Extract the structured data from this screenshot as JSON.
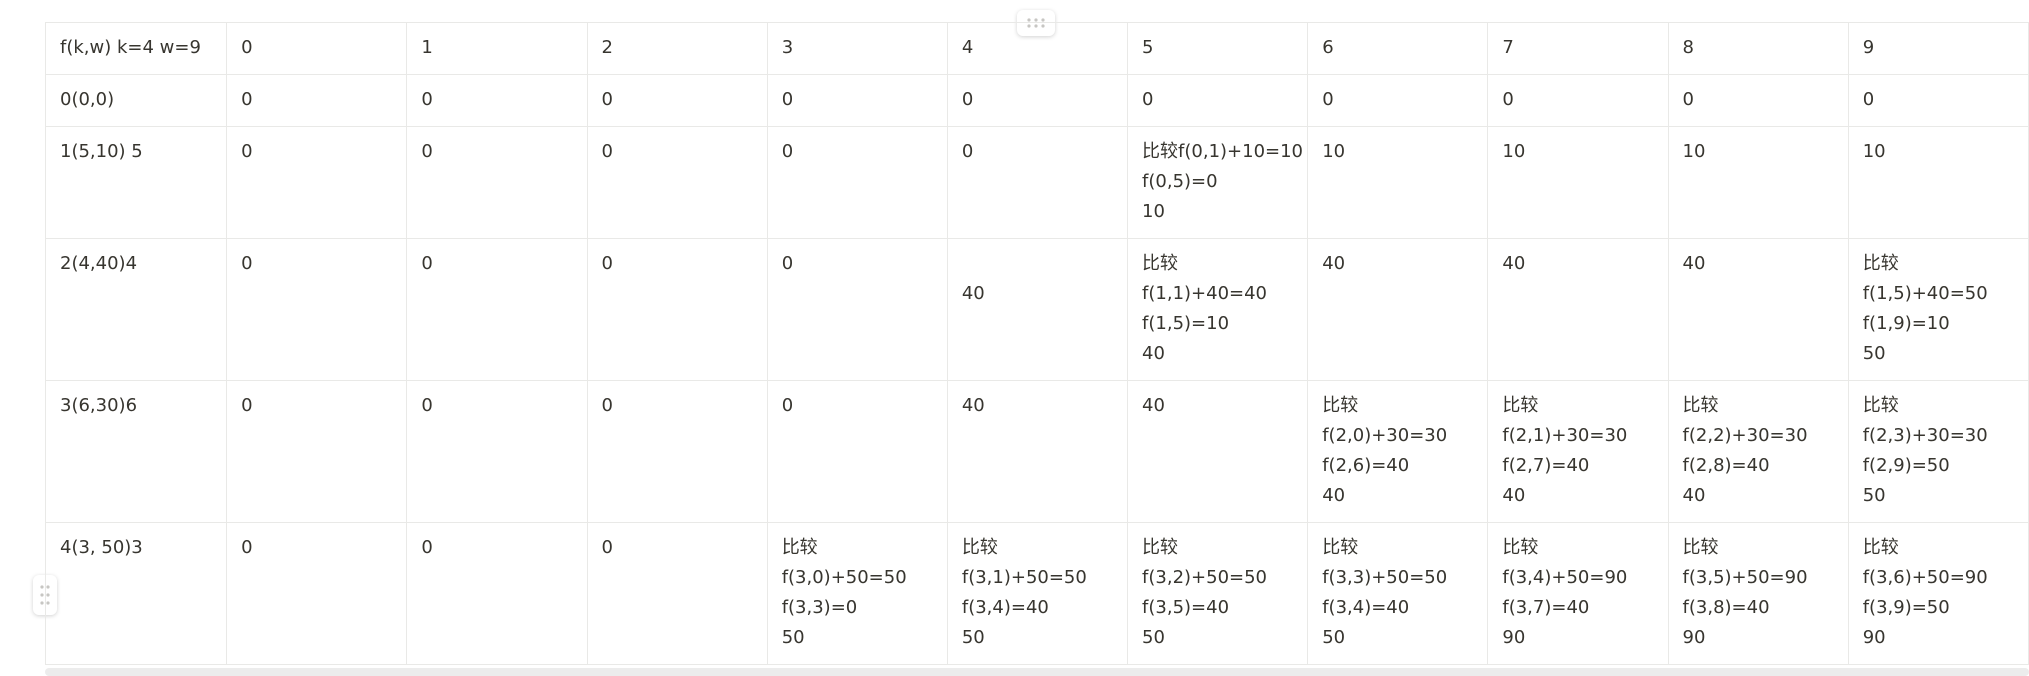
{
  "table": {
    "header": [
      "f(k,w)  k=4 w=9",
      "0",
      "1",
      "2",
      "3",
      "4",
      "5",
      "6",
      "7",
      "8",
      "9"
    ],
    "rows": [
      {
        "cells": [
          [
            "0(0,0)"
          ],
          [
            "0"
          ],
          [
            "0"
          ],
          [
            "0"
          ],
          [
            "0"
          ],
          [
            "0"
          ],
          [
            "0"
          ],
          [
            "0"
          ],
          [
            "0"
          ],
          [
            "0"
          ],
          [
            "0"
          ]
        ]
      },
      {
        "cells": [
          [
            "1(5,10) 5"
          ],
          [
            "0"
          ],
          [
            "0"
          ],
          [
            "0"
          ],
          [
            "0"
          ],
          [
            "0"
          ],
          [
            "比较f(0,1)+10=10",
            "f(0,5)=0",
            "10"
          ],
          [
            "10"
          ],
          [
            "10"
          ],
          [
            "10"
          ],
          [
            "10"
          ]
        ]
      },
      {
        "cells": [
          [
            "2(4,40)4"
          ],
          [
            "0"
          ],
          [
            "0"
          ],
          [
            "0"
          ],
          [
            "0"
          ],
          [
            "",
            "40"
          ],
          [
            "比较",
            "f(1,1)+40=40",
            "f(1,5)=10",
            "40"
          ],
          [
            "40"
          ],
          [
            "40"
          ],
          [
            "40"
          ],
          [
            "比较",
            "f(1,5)+40=50",
            "f(1,9)=10",
            "50"
          ]
        ]
      },
      {
        "cells": [
          [
            "3(6,30)6"
          ],
          [
            "0"
          ],
          [
            "0"
          ],
          [
            "0"
          ],
          [
            "0"
          ],
          [
            "40"
          ],
          [
            "40"
          ],
          [
            "比较",
            "f(2,0)+30=30",
            "f(2,6)=40",
            "40"
          ],
          [
            "比较",
            "f(2,1)+30=30",
            "f(2,7)=40",
            "40"
          ],
          [
            "比较",
            "f(2,2)+30=30",
            "f(2,8)=40",
            "40"
          ],
          [
            "比较",
            "f(2,3)+30=30",
            "f(2,9)=50",
            "50"
          ]
        ]
      },
      {
        "cells": [
          [
            "4(3, 50)3"
          ],
          [
            "0"
          ],
          [
            "0"
          ],
          [
            "0"
          ],
          [
            "比较",
            "f(3,0)+50=50",
            "f(3,3)=0",
            "50"
          ],
          [
            "比较",
            "f(3,1)+50=50",
            "f(3,4)=40",
            "50"
          ],
          [
            "比较",
            "f(3,2)+50=50",
            "f(3,5)=40",
            "50"
          ],
          [
            "比较",
            "f(3,3)+50=50",
            "f(3,4)=40",
            "50"
          ],
          [
            "比较",
            "f(3,4)+50=90",
            "f(3,7)=40",
            "90"
          ],
          [
            "比较",
            "f(3,5)+50=90",
            "f(3,8)=40",
            "90"
          ],
          [
            "比较",
            "f(3,6)+50=90",
            "f(3,9)=50",
            "90"
          ]
        ]
      }
    ]
  },
  "icons": {
    "column_handle": "drag-handle-dots-icon",
    "row_handle": "drag-handle-dots-icon"
  },
  "colors": {
    "grid_border": "#e9e9e7",
    "text": "#37352f",
    "handle_dots": "#c7c6c3",
    "scrollbar": "#ececec"
  }
}
